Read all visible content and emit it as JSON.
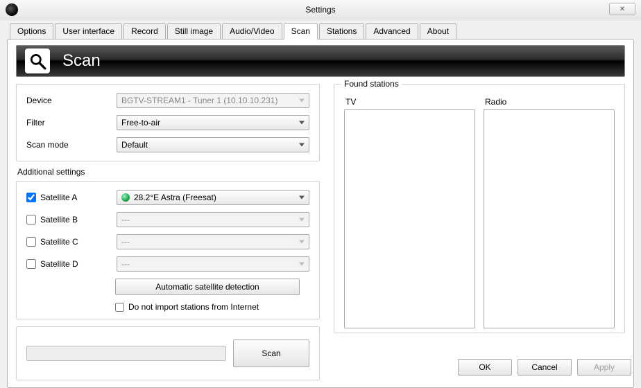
{
  "window": {
    "title": "Settings",
    "close_glyph": "✕"
  },
  "tabs": [
    {
      "label": "Options"
    },
    {
      "label": "User interface"
    },
    {
      "label": "Record"
    },
    {
      "label": "Still image"
    },
    {
      "label": "Audio/Video"
    },
    {
      "label": "Scan",
      "active": true
    },
    {
      "label": "Stations"
    },
    {
      "label": "Advanced"
    },
    {
      "label": "About"
    }
  ],
  "banner": {
    "title": "Scan"
  },
  "form": {
    "device_label": "Device",
    "device_value": "BGTV-STREAM1 - Tuner 1 (10.10.10.231)",
    "filter_label": "Filter",
    "filter_value": "Free-to-air",
    "scanmode_label": "Scan mode",
    "scanmode_value": "Default"
  },
  "additional": {
    "title": "Additional settings",
    "satA": {
      "label": "Satellite A",
      "checked": true,
      "value": "28.2°E Astra (Freesat)"
    },
    "satB": {
      "label": "Satellite B",
      "checked": false,
      "value": "---"
    },
    "satC": {
      "label": "Satellite C",
      "checked": false,
      "value": "---"
    },
    "satD": {
      "label": "Satellite D",
      "checked": false,
      "value": "---"
    },
    "auto_detect": "Automatic satellite detection",
    "no_import": "Do not import stations from Internet"
  },
  "scan": {
    "button": "Scan"
  },
  "found": {
    "legend": "Found stations",
    "tv_label": "TV",
    "radio_label": "Radio"
  },
  "footer": {
    "ok": "OK",
    "cancel": "Cancel",
    "apply": "Apply"
  }
}
